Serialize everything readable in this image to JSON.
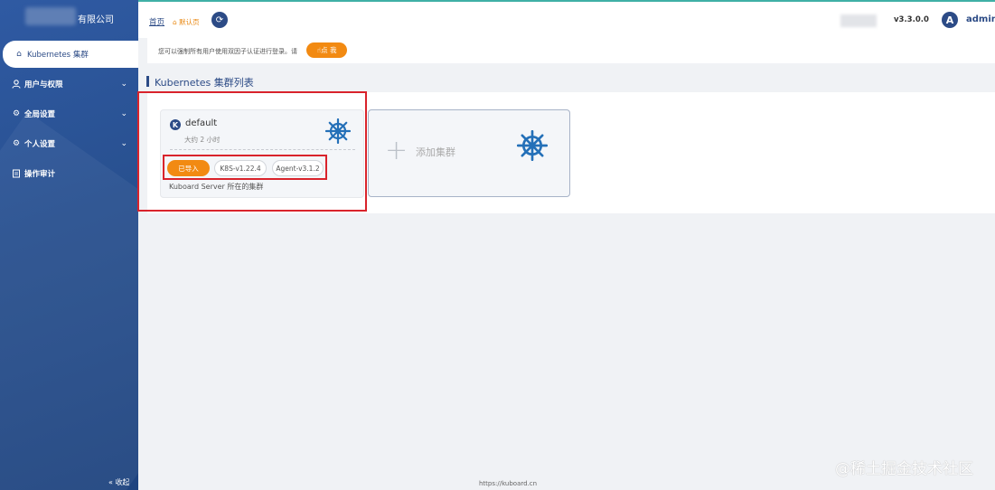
{
  "brand": {
    "company": "有限公司"
  },
  "sidebar": {
    "items": [
      {
        "label": "Kubernetes 集群",
        "icon": "home-icon"
      },
      {
        "label": "用户与权限",
        "icon": "user-icon"
      },
      {
        "label": "全局设置",
        "icon": "gear-icon"
      },
      {
        "label": "个人设置",
        "icon": "gear-icon"
      },
      {
        "label": "操作审计",
        "icon": "audit-icon"
      }
    ],
    "collapse_label": "« 收起"
  },
  "header": {
    "breadcrumb_home": "首页",
    "breadcrumb_current": "默认页",
    "version": "v3.3.0.0",
    "avatar_letter": "A",
    "username": "admin"
  },
  "notice": {
    "text": "您可以强制所有用户使用双因子认证进行登录。请",
    "button": "点 我"
  },
  "section": {
    "title": "Kubernetes 集群列表"
  },
  "cluster_card": {
    "badge": "K",
    "name": "default",
    "time": "大约 2 小时",
    "tags": [
      "已导入",
      "K8S-v1.22.4",
      "Agent-v3.1.2"
    ],
    "description": "Kuboard Server 所在的集群"
  },
  "add_card": {
    "label": "添加集群"
  },
  "footer": {
    "url": "https://kuboard.cn"
  },
  "watermark": "@稀土掘金技术社区",
  "colors": {
    "brand": "#2c4b86",
    "accent": "#f28a12",
    "highlight": "#d9232b"
  }
}
